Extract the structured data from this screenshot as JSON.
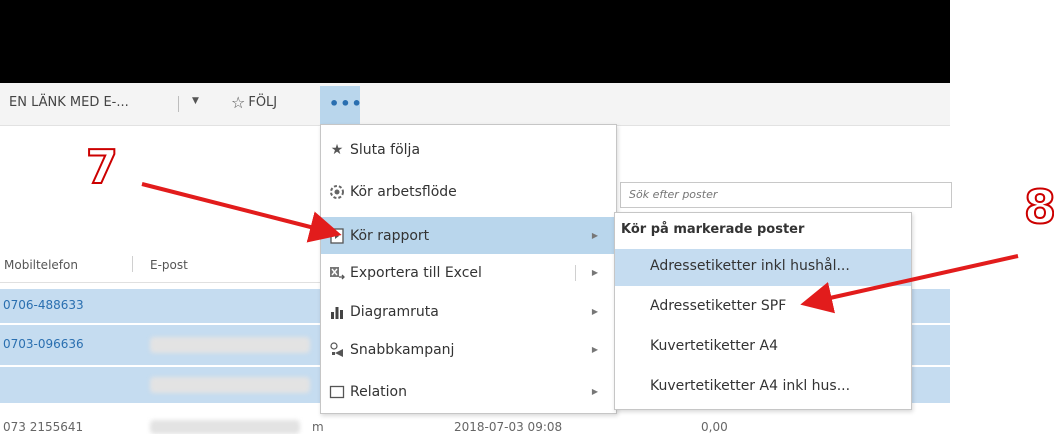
{
  "toolbar": {
    "link_label": "EN LÄNK MED E-...",
    "follow_label": "FÖLJ",
    "more_label": "•••"
  },
  "search": {
    "placeholder": "Sök efter poster"
  },
  "grid": {
    "columns": [
      "Mobiltelefon",
      "E-post"
    ],
    "rows": [
      {
        "phone": "0706-488633"
      },
      {
        "phone": "0703-096636"
      },
      {
        "phone": ""
      },
      {
        "phone": "073 2155641",
        "email_partial": "m",
        "date": "2018-07-03 09:08",
        "amount": "0,00"
      }
    ]
  },
  "menu": {
    "items": [
      {
        "label": "Sluta följa",
        "icon": "star-icon"
      },
      {
        "label": "Kör arbetsflöde",
        "icon": "workflow-icon"
      },
      {
        "label": "Kör rapport",
        "icon": "report-icon"
      },
      {
        "label": "Exportera till Excel",
        "icon": "excel-icon"
      },
      {
        "label": "Diagramruta",
        "icon": "chart-icon"
      },
      {
        "label": "Snabbkampanj",
        "icon": "campaign-icon"
      },
      {
        "label": "Relation",
        "icon": "relation-icon"
      }
    ]
  },
  "submenu": {
    "header": "Kör på markerade poster",
    "items": [
      "Adressetiketter inkl hushål...",
      "Adressetiketter SPF",
      "Kuvertetiketter A4",
      "Kuvertetiketter A4 inkl hus..."
    ]
  },
  "annotations": {
    "step7": "7",
    "step8": "8",
    "arrow_color": "#e21c1c"
  }
}
